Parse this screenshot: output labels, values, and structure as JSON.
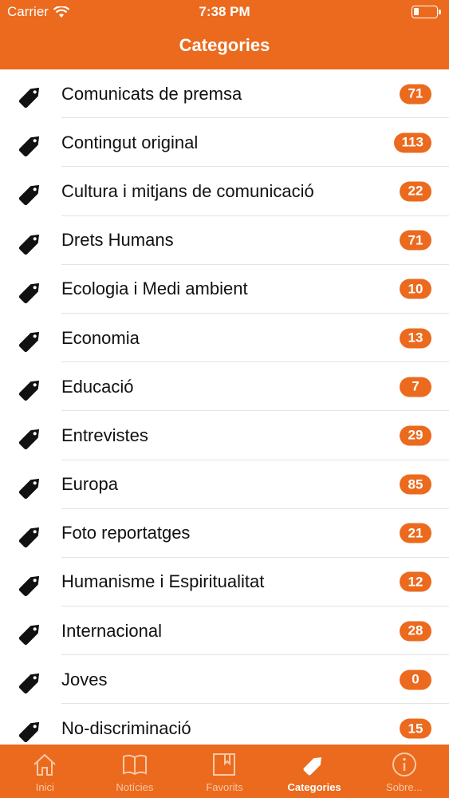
{
  "status_bar": {
    "carrier": "Carrier",
    "time": "7:38 PM"
  },
  "header": {
    "title": "Categories"
  },
  "categories": [
    {
      "name": "Comunicats de premsa",
      "count": "71"
    },
    {
      "name": "Contingut original",
      "count": "113"
    },
    {
      "name": "Cultura i mitjans de comunicació",
      "count": "22"
    },
    {
      "name": "Drets Humans",
      "count": "71"
    },
    {
      "name": "Ecologia i Medi ambient",
      "count": "10"
    },
    {
      "name": "Economia",
      "count": "13"
    },
    {
      "name": "Educació",
      "count": "7"
    },
    {
      "name": "Entrevistes",
      "count": "29"
    },
    {
      "name": "Europa",
      "count": "85"
    },
    {
      "name": "Foto reportatges",
      "count": "21"
    },
    {
      "name": "Humanisme i Espiritualitat",
      "count": "12"
    },
    {
      "name": "Internacional",
      "count": "28"
    },
    {
      "name": "Joves",
      "count": "0"
    },
    {
      "name": "No-discriminació",
      "count": "15"
    }
  ],
  "tabs": [
    {
      "label": "Inici",
      "icon": "home-icon",
      "active": false
    },
    {
      "label": "Notícies",
      "icon": "book-icon",
      "active": false
    },
    {
      "label": "Favorits",
      "icon": "bookmark-icon",
      "active": false
    },
    {
      "label": "Categories",
      "icon": "tag-icon",
      "active": true
    },
    {
      "label": "Sobre...",
      "icon": "info-icon",
      "active": false
    }
  ],
  "colors": {
    "accent": "#EB6A1E",
    "inactive_tab": "#F9C9A8"
  }
}
